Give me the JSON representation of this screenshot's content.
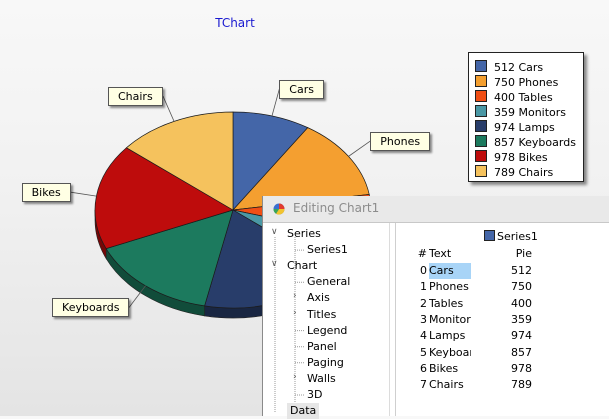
{
  "chart_data": {
    "type": "pie",
    "title": "TChart",
    "slices": [
      {
        "label": "Cars",
        "value": 512,
        "color": "#4466a8"
      },
      {
        "label": "Phones",
        "value": 750,
        "color": "#f49f30"
      },
      {
        "label": "Tables",
        "value": 400,
        "color": "#f04e14"
      },
      {
        "label": "Monitors",
        "value": 359,
        "color": "#4a98a5"
      },
      {
        "label": "Lamps",
        "value": 974,
        "color": "#283d6a"
      },
      {
        "label": "Keyboards",
        "value": 857,
        "color": "#1c7a5e"
      },
      {
        "label": "Bikes",
        "value": 978,
        "color": "#be0c0c"
      },
      {
        "label": "Chairs",
        "value": 789,
        "color": "#f5c25d"
      }
    ],
    "legend_position": "right",
    "legend_entries": [
      "512 Cars",
      "750 Phones",
      "400 Tables",
      "359 Monitors",
      "974 Lamps",
      "857 Keyboards",
      "978 Bikes",
      "789 Chairs"
    ],
    "style": "3d"
  },
  "editor": {
    "title": "Editing Chart1",
    "tree": [
      {
        "label": "Series",
        "level": 0,
        "arrow": "down"
      },
      {
        "label": "Series1",
        "level": 2,
        "arrow": ""
      },
      {
        "label": "Chart",
        "level": 0,
        "arrow": "down"
      },
      {
        "label": "General",
        "level": 2,
        "arrow": ""
      },
      {
        "label": "Axis",
        "level": 1,
        "arrow": "right"
      },
      {
        "label": "Titles",
        "level": 1,
        "arrow": "right"
      },
      {
        "label": "Legend",
        "level": 2,
        "arrow": ""
      },
      {
        "label": "Panel",
        "level": 2,
        "arrow": ""
      },
      {
        "label": "Paging",
        "level": 2,
        "arrow": ""
      },
      {
        "label": "Walls",
        "level": 1,
        "arrow": "right"
      },
      {
        "label": "3D",
        "level": 2,
        "arrow": ""
      },
      {
        "label": "Data",
        "level": 0,
        "arrow": ""
      }
    ],
    "grid": {
      "series_name": "Series1",
      "series_color": "#4466a8",
      "headers": [
        "#",
        "Text",
        "Pie"
      ],
      "rows": [
        [
          "0",
          "Cars",
          "512"
        ],
        [
          "1",
          "Phones",
          "750"
        ],
        [
          "2",
          "Tables",
          "400"
        ],
        [
          "3",
          "Monitors",
          "359"
        ],
        [
          "4",
          "Lamps",
          "974"
        ],
        [
          "5",
          "Keyboards",
          "857"
        ],
        [
          "6",
          "Bikes",
          "978"
        ],
        [
          "7",
          "Chairs",
          "789"
        ]
      ]
    }
  }
}
